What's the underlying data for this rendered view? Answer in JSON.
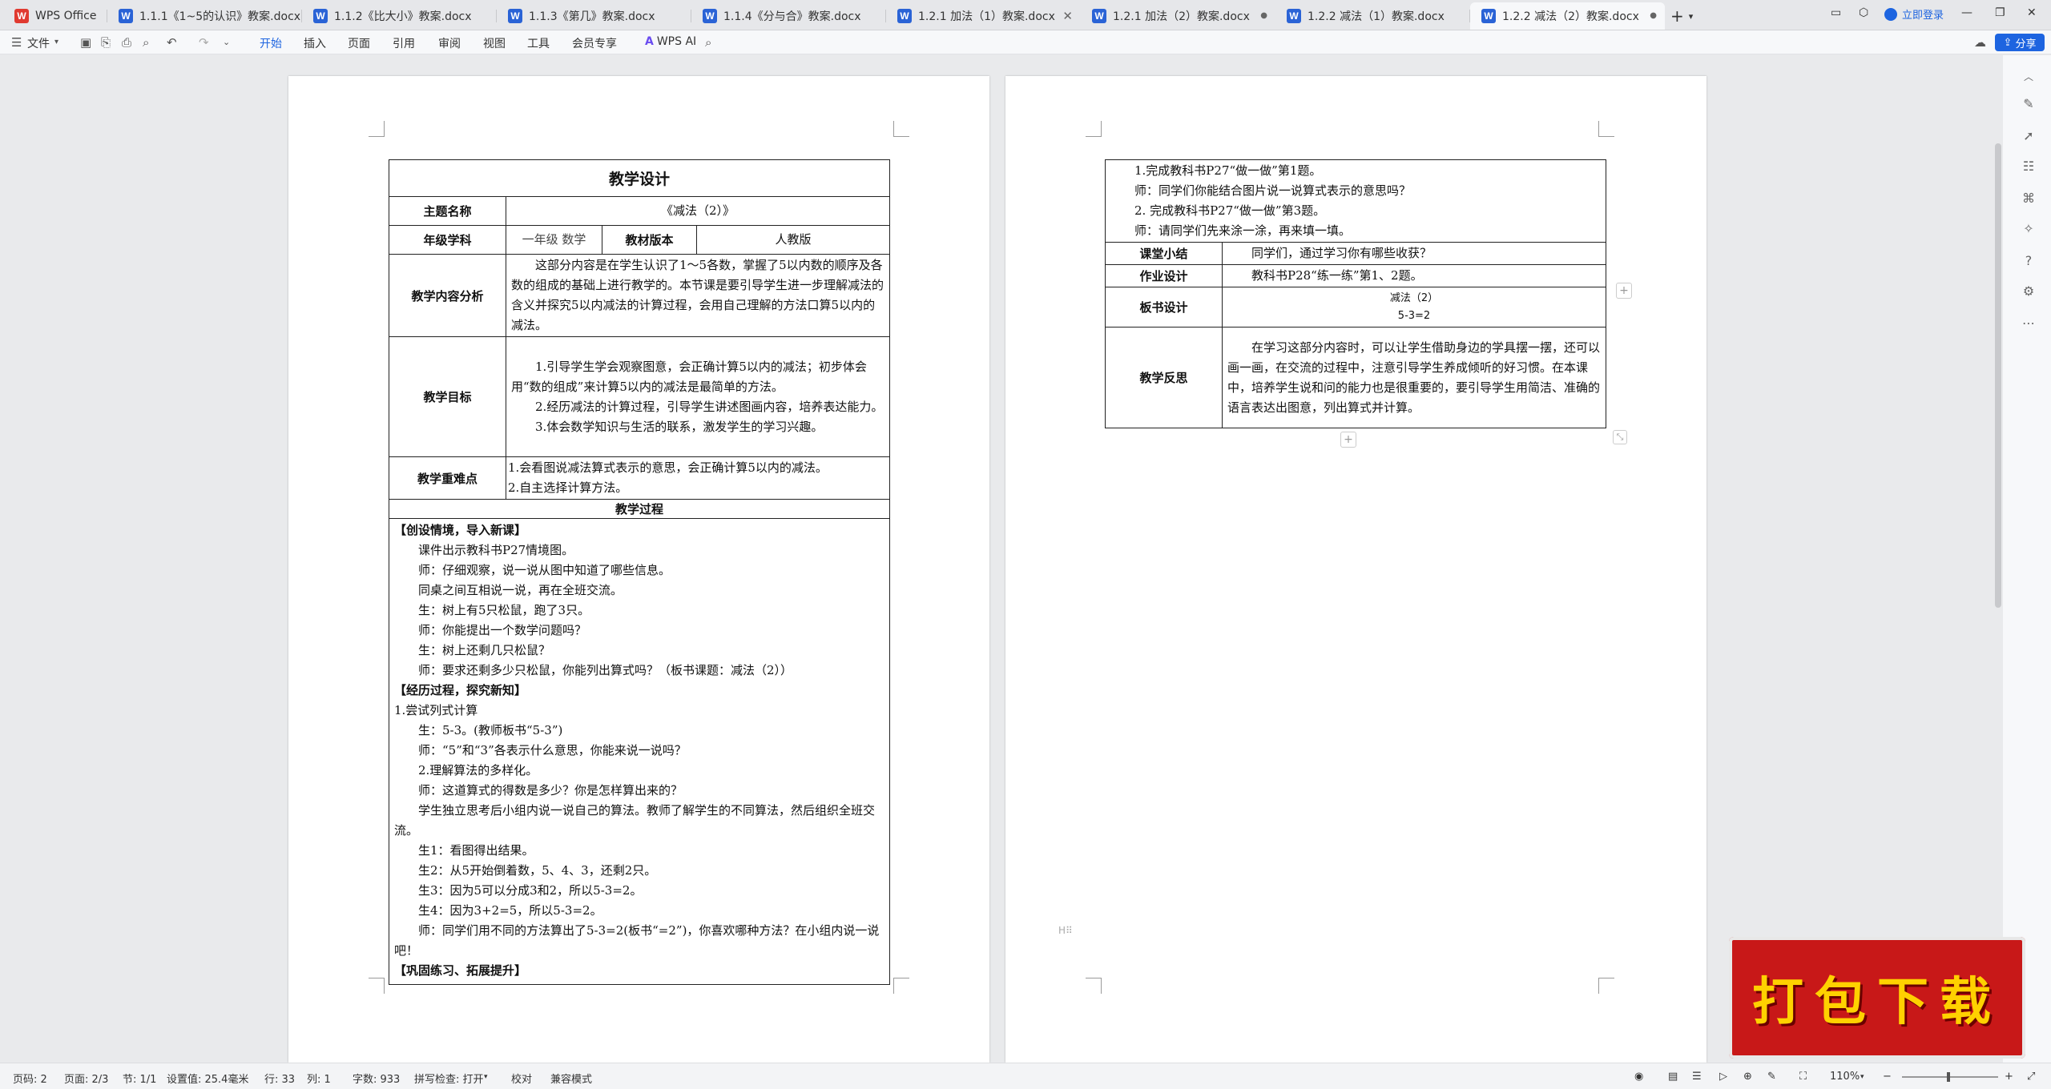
{
  "tabs": [
    {
      "label": "WPS Office",
      "icon": "wps-logo-icon"
    },
    {
      "label": "1.1.1《1~5的认识》教案.docx",
      "icon": "word-doc-icon"
    },
    {
      "label": "1.1.2《比大小》教案.docx",
      "icon": "word-doc-icon"
    },
    {
      "label": "1.1.3《第几》教案.docx",
      "icon": "word-doc-icon"
    },
    {
      "label": "1.1.4《分与合》教案.docx",
      "icon": "word-doc-icon"
    },
    {
      "label": "1.2.1 加法（1）教案.docx",
      "icon": "word-doc-icon"
    },
    {
      "label": "1.2.1 加法（2）教案.docx",
      "icon": "word-doc-icon"
    },
    {
      "label": "1.2.2 减法（1）教案.docx",
      "icon": "word-doc-icon"
    },
    {
      "label": "1.2.2 减法（2）教案.docx",
      "icon": "word-doc-icon"
    }
  ],
  "titlebar": {
    "login_label": "立即登录",
    "share_label": "分享"
  },
  "menu": {
    "file": "文件",
    "items": [
      "开始",
      "插入",
      "页面",
      "引用",
      "审阅",
      "视图",
      "工具",
      "会员专享"
    ],
    "wps_ai": "WPS AI"
  },
  "doc": {
    "title": "教学设计",
    "topic_label": "主题名称",
    "topic_value": "《减法（2）》",
    "grade_label": "年级学科",
    "grade_value": "一年级  数学",
    "edition_label": "教材版本",
    "edition_value": "人教版",
    "analysis_label": "教学内容分析",
    "analysis_text": "这部分内容是在学生认识了1～5各数，掌握了5以内数的顺序及各数的组成的基础上进行教学的。本节课是要引导学生进一步理解减法的含义并探究5以内减法的计算过程，会用自己理解的方法口算5以内的减法。",
    "goals_label": "教学目标",
    "goals": [
      "1.引导学生学会观察图意，会正确计算5以内的减法；初步体会用“数的组成”来计算5以内的减法是最简单的方法。",
      "2.经历减法的计算过程，引导学生讲述图画内容，培养表达能力。",
      "3.体会数学知识与生活的联系，激发学生的学习兴趣。"
    ],
    "keypoints_label": "教学重难点",
    "keypoints": [
      "1.会看图说减法算式表示的意思，会正确计算5以内的减法。",
      "2.自主选择计算方法。"
    ],
    "process_label": "教学过程",
    "process": [
      {
        "text": "【创设情境，导入新课】",
        "bold": true,
        "indent": false
      },
      {
        "text": "课件出示教科书P27情境图。",
        "bold": false,
        "indent": true
      },
      {
        "text": "师：仔细观察，说一说从图中知道了哪些信息。",
        "bold": false,
        "indent": true
      },
      {
        "text": "同桌之间互相说一说，再在全班交流。",
        "bold": false,
        "indent": true
      },
      {
        "text": "生：树上有5只松鼠，跑了3只。",
        "bold": false,
        "indent": true
      },
      {
        "text": "师：你能提出一个数学问题吗？",
        "bold": false,
        "indent": true
      },
      {
        "text": "生：树上还剩几只松鼠？",
        "bold": false,
        "indent": true
      },
      {
        "text": "师：要求还剩多少只松鼠，你能列出算式吗？（板书课题：减法（2））",
        "bold": false,
        "indent": true
      },
      {
        "text": "【经历过程，探究新知】",
        "bold": true,
        "indent": false
      },
      {
        "text": " 1.尝试列式计算",
        "bold": false,
        "indent": false
      },
      {
        "text": "生：5-3。(教师板书“5-3”)",
        "bold": false,
        "indent": true
      },
      {
        "text": "师：“5”和“3”各表示什么意思，你能来说一说吗？",
        "bold": false,
        "indent": true
      },
      {
        "text": "2.理解算法的多样化。",
        "bold": false,
        "indent": true
      },
      {
        "text": "师：这道算式的得数是多少？你是怎样算出来的？",
        "bold": false,
        "indent": true
      },
      {
        "text": "学生独立思考后小组内说一说自己的算法。教师了解学生的不同算法，然后组织全班交流。",
        "bold": false,
        "indent": true
      },
      {
        "text": "生1：看图得出结果。",
        "bold": false,
        "indent": true
      },
      {
        "text": "生2：从5开始倒着数，5、4、3，还剩2只。",
        "bold": false,
        "indent": true
      },
      {
        "text": "生3：因为5可以分成3和2，所以5-3=2。",
        "bold": false,
        "indent": true
      },
      {
        "text": "生4：因为3+2=5，所以5-3=2。",
        "bold": false,
        "indent": true
      },
      {
        "text": "师：同学们用不同的方法算出了5-3=2(板书“=2”)，你喜欢哪种方法？在小组内说一说吧！",
        "bold": false,
        "indent": true
      },
      {
        "text": "【巩固练习、拓展提升】",
        "bold": true,
        "indent": false
      }
    ],
    "p2_lines": [
      "1.完成教科书P27“做一做”第1题。",
      "师：同学们你能结合图片说一说算式表示的意思吗？",
      "2. 完成教科书P27“做一做”第3题。",
      "师：请同学们先来涂一涂，再来填一填。"
    ],
    "summary_label": "课堂小结",
    "summary_text": "同学们，通过学习你有哪些收获？",
    "homework_label": "作业设计",
    "homework_text": "教科书P28“练一练”第1、2题。",
    "board_label": "板书设计",
    "board_title": "减法（2）",
    "board_formula": "5-3=2",
    "reflect_label": "教学反思",
    "reflect_text": "在学习这部分内容时，可以让学生借助身边的学具摆一摆，还可以画一画，在交流的过程中，注意引导学生养成倾听的好习惯。在本课中，培养学生说和问的能力也是很重要的，要引导学生用简洁、准确的语言表达出图意，列出算式并计算。"
  },
  "status": {
    "page_no": "页码: 2",
    "pages": "页面: 2/3",
    "section": "节: 1/1",
    "setting": "设置值: 25.4毫米",
    "row": "行: 33",
    "col": "列: 1",
    "words": "字数: 933",
    "spell": "拼写检查: 打开",
    "proof": "校对",
    "compat": "兼容模式",
    "zoom": "110%"
  },
  "promo": {
    "label": "打包下载"
  }
}
